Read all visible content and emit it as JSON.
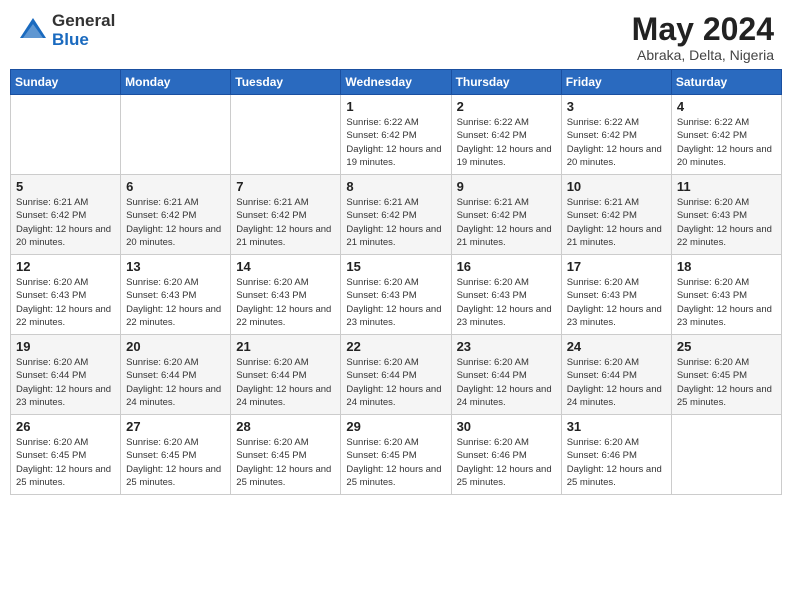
{
  "header": {
    "logo_general": "General",
    "logo_blue": "Blue",
    "month_title": "May 2024",
    "location": "Abraka, Delta, Nigeria"
  },
  "days_of_week": [
    "Sunday",
    "Monday",
    "Tuesday",
    "Wednesday",
    "Thursday",
    "Friday",
    "Saturday"
  ],
  "weeks": [
    [
      {
        "day": "",
        "info": ""
      },
      {
        "day": "",
        "info": ""
      },
      {
        "day": "",
        "info": ""
      },
      {
        "day": "1",
        "info": "Sunrise: 6:22 AM\nSunset: 6:42 PM\nDaylight: 12 hours\nand 19 minutes."
      },
      {
        "day": "2",
        "info": "Sunrise: 6:22 AM\nSunset: 6:42 PM\nDaylight: 12 hours\nand 19 minutes."
      },
      {
        "day": "3",
        "info": "Sunrise: 6:22 AM\nSunset: 6:42 PM\nDaylight: 12 hours\nand 20 minutes."
      },
      {
        "day": "4",
        "info": "Sunrise: 6:22 AM\nSunset: 6:42 PM\nDaylight: 12 hours\nand 20 minutes."
      }
    ],
    [
      {
        "day": "5",
        "info": "Sunrise: 6:21 AM\nSunset: 6:42 PM\nDaylight: 12 hours\nand 20 minutes."
      },
      {
        "day": "6",
        "info": "Sunrise: 6:21 AM\nSunset: 6:42 PM\nDaylight: 12 hours\nand 20 minutes."
      },
      {
        "day": "7",
        "info": "Sunrise: 6:21 AM\nSunset: 6:42 PM\nDaylight: 12 hours\nand 21 minutes."
      },
      {
        "day": "8",
        "info": "Sunrise: 6:21 AM\nSunset: 6:42 PM\nDaylight: 12 hours\nand 21 minutes."
      },
      {
        "day": "9",
        "info": "Sunrise: 6:21 AM\nSunset: 6:42 PM\nDaylight: 12 hours\nand 21 minutes."
      },
      {
        "day": "10",
        "info": "Sunrise: 6:21 AM\nSunset: 6:42 PM\nDaylight: 12 hours\nand 21 minutes."
      },
      {
        "day": "11",
        "info": "Sunrise: 6:20 AM\nSunset: 6:43 PM\nDaylight: 12 hours\nand 22 minutes."
      }
    ],
    [
      {
        "day": "12",
        "info": "Sunrise: 6:20 AM\nSunset: 6:43 PM\nDaylight: 12 hours\nand 22 minutes."
      },
      {
        "day": "13",
        "info": "Sunrise: 6:20 AM\nSunset: 6:43 PM\nDaylight: 12 hours\nand 22 minutes."
      },
      {
        "day": "14",
        "info": "Sunrise: 6:20 AM\nSunset: 6:43 PM\nDaylight: 12 hours\nand 22 minutes."
      },
      {
        "day": "15",
        "info": "Sunrise: 6:20 AM\nSunset: 6:43 PM\nDaylight: 12 hours\nand 23 minutes."
      },
      {
        "day": "16",
        "info": "Sunrise: 6:20 AM\nSunset: 6:43 PM\nDaylight: 12 hours\nand 23 minutes."
      },
      {
        "day": "17",
        "info": "Sunrise: 6:20 AM\nSunset: 6:43 PM\nDaylight: 12 hours\nand 23 minutes."
      },
      {
        "day": "18",
        "info": "Sunrise: 6:20 AM\nSunset: 6:43 PM\nDaylight: 12 hours\nand 23 minutes."
      }
    ],
    [
      {
        "day": "19",
        "info": "Sunrise: 6:20 AM\nSunset: 6:44 PM\nDaylight: 12 hours\nand 23 minutes."
      },
      {
        "day": "20",
        "info": "Sunrise: 6:20 AM\nSunset: 6:44 PM\nDaylight: 12 hours\nand 24 minutes."
      },
      {
        "day": "21",
        "info": "Sunrise: 6:20 AM\nSunset: 6:44 PM\nDaylight: 12 hours\nand 24 minutes."
      },
      {
        "day": "22",
        "info": "Sunrise: 6:20 AM\nSunset: 6:44 PM\nDaylight: 12 hours\nand 24 minutes."
      },
      {
        "day": "23",
        "info": "Sunrise: 6:20 AM\nSunset: 6:44 PM\nDaylight: 12 hours\nand 24 minutes."
      },
      {
        "day": "24",
        "info": "Sunrise: 6:20 AM\nSunset: 6:44 PM\nDaylight: 12 hours\nand 24 minutes."
      },
      {
        "day": "25",
        "info": "Sunrise: 6:20 AM\nSunset: 6:45 PM\nDaylight: 12 hours\nand 25 minutes."
      }
    ],
    [
      {
        "day": "26",
        "info": "Sunrise: 6:20 AM\nSunset: 6:45 PM\nDaylight: 12 hours\nand 25 minutes."
      },
      {
        "day": "27",
        "info": "Sunrise: 6:20 AM\nSunset: 6:45 PM\nDaylight: 12 hours\nand 25 minutes."
      },
      {
        "day": "28",
        "info": "Sunrise: 6:20 AM\nSunset: 6:45 PM\nDaylight: 12 hours\nand 25 minutes."
      },
      {
        "day": "29",
        "info": "Sunrise: 6:20 AM\nSunset: 6:45 PM\nDaylight: 12 hours\nand 25 minutes."
      },
      {
        "day": "30",
        "info": "Sunrise: 6:20 AM\nSunset: 6:46 PM\nDaylight: 12 hours\nand 25 minutes."
      },
      {
        "day": "31",
        "info": "Sunrise: 6:20 AM\nSunset: 6:46 PM\nDaylight: 12 hours\nand 25 minutes."
      },
      {
        "day": "",
        "info": ""
      }
    ]
  ]
}
